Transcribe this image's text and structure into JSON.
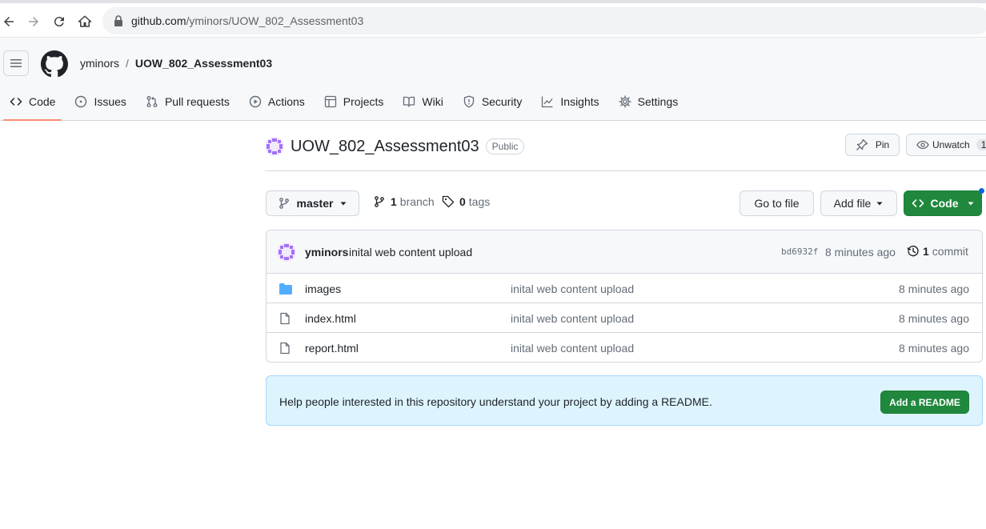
{
  "browser": {
    "url_host": "github.com",
    "url_path": "/yminors/UOW_802_Assessment03"
  },
  "header": {
    "owner": "yminors",
    "separator": "/",
    "repo": "UOW_802_Assessment03"
  },
  "tabs": [
    {
      "label": "Code",
      "icon": "code-icon",
      "selected": true
    },
    {
      "label": "Issues",
      "icon": "issue-icon"
    },
    {
      "label": "Pull requests",
      "icon": "pull-request-icon"
    },
    {
      "label": "Actions",
      "icon": "play-icon"
    },
    {
      "label": "Projects",
      "icon": "table-icon"
    },
    {
      "label": "Wiki",
      "icon": "book-icon"
    },
    {
      "label": "Security",
      "icon": "shield-icon"
    },
    {
      "label": "Insights",
      "icon": "graph-icon"
    },
    {
      "label": "Settings",
      "icon": "gear-icon"
    }
  ],
  "repo": {
    "name": "UOW_802_Assessment03",
    "visibility": "Public",
    "pin_label": "Pin",
    "unwatch_label": "Unwatch",
    "watch_count": "1"
  },
  "toolbar": {
    "branch": "master",
    "branch_count": "1",
    "branch_label": "branch",
    "tag_count": "0",
    "tag_label": "tags",
    "go_to_file": "Go to file",
    "add_file": "Add file",
    "code": "Code"
  },
  "latest_commit": {
    "author": "yminors",
    "message": "inital web content upload",
    "sha": "bd6932f",
    "time": "8 minutes ago",
    "commit_count": "1",
    "commit_label": "commit"
  },
  "files": [
    {
      "name": "images",
      "type": "folder",
      "message": "inital web content upload",
      "age": "8 minutes ago"
    },
    {
      "name": "index.html",
      "type": "file",
      "message": "inital web content upload",
      "age": "8 minutes ago"
    },
    {
      "name": "report.html",
      "type": "file",
      "message": "inital web content upload",
      "age": "8 minutes ago"
    }
  ],
  "readme": {
    "text": "Help people interested in this repository understand your project by adding a README.",
    "button": "Add a README"
  },
  "colors": {
    "accent_green": "#1f883d",
    "tab_underline": "#fd8c73",
    "readme_bg": "#ddf4ff",
    "folder_blue": "#54aeff",
    "avatar_purple": "#a371f7"
  }
}
